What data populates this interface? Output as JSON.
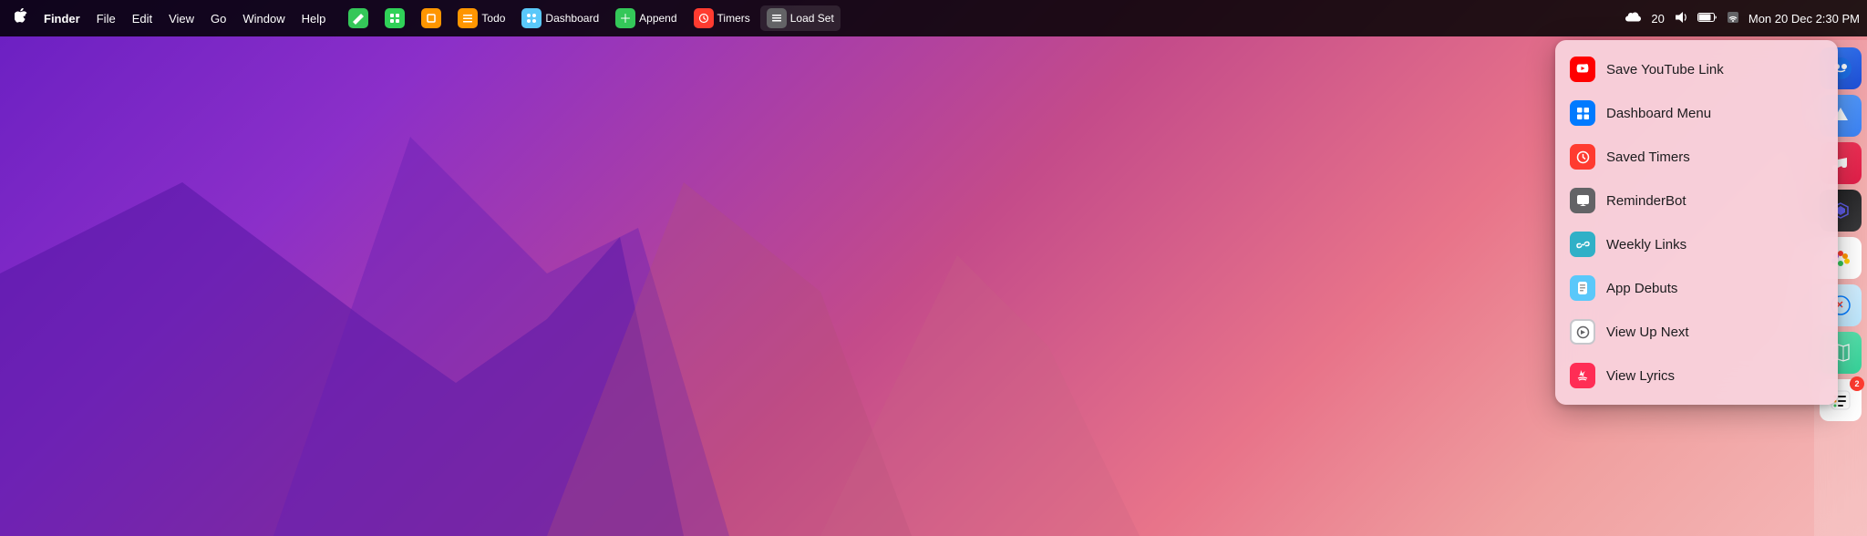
{
  "menubar": {
    "apple_logo": "",
    "finder_label": "Finder",
    "menus": [
      "File",
      "Edit",
      "View",
      "Go",
      "Window",
      "Help"
    ],
    "apps": [
      {
        "id": "pencil",
        "label": "",
        "icon_char": "✏️",
        "color": "#34c759"
      },
      {
        "id": "green",
        "label": "",
        "icon_char": "▣",
        "color": "#30d158"
      },
      {
        "id": "orange-sq",
        "label": "",
        "icon_char": "□",
        "color": "#ff9500"
      },
      {
        "id": "todo",
        "label": "Todo",
        "icon_char": "☰",
        "color": "#ff9500"
      },
      {
        "id": "dashboard",
        "label": "Dashboard",
        "icon_char": "⊞",
        "color": "#5ac8fa"
      },
      {
        "id": "append",
        "label": "Append",
        "icon_char": "+",
        "color": "#34c759"
      },
      {
        "id": "timers",
        "label": "Timers",
        "icon_char": "⏱",
        "color": "#ff3b30"
      },
      {
        "id": "loadset",
        "label": "Load Set",
        "icon_char": "≡",
        "color": "#636366"
      }
    ],
    "system_icons": [
      "icloud",
      "calendar",
      "volume",
      "battery",
      "wifi"
    ],
    "datetime": "Mon 20 Dec  2:30 PM"
  },
  "dropdown": {
    "items": [
      {
        "id": "save-youtube",
        "label": "Save YouTube Link",
        "icon_type": "youtube",
        "icon_char": "▶"
      },
      {
        "id": "dashboard-menu",
        "label": "Dashboard Menu",
        "icon_type": "dashboard",
        "icon_char": "⊞"
      },
      {
        "id": "saved-timers",
        "label": "Saved Timers",
        "icon_type": "timers",
        "icon_char": "⏱"
      },
      {
        "id": "reminder-bot",
        "label": "ReminderBot",
        "icon_type": "reminder",
        "icon_char": "⊡"
      },
      {
        "id": "weekly-links",
        "label": "Weekly Links",
        "icon_type": "weekly",
        "icon_char": "🔗"
      },
      {
        "id": "app-debuts",
        "label": "App Debuts",
        "icon_type": "debuts",
        "icon_char": "📱"
      },
      {
        "id": "view-up-next",
        "label": "View Up Next",
        "icon_type": "upnext",
        "icon_char": "⏭"
      },
      {
        "id": "view-lyrics",
        "label": "View Lyrics",
        "icon_type": "lyrics",
        "icon_char": "♪"
      }
    ]
  },
  "dock": {
    "icons": [
      {
        "id": "finder",
        "color": "#007aff",
        "char": "🔵",
        "badge": null
      },
      {
        "id": "appstore",
        "color": "#007aff",
        "char": "🅰",
        "badge": null
      },
      {
        "id": "music",
        "color": "#ff2d55",
        "char": "🎵",
        "badge": null
      },
      {
        "id": "shortcuts",
        "color": "#111",
        "char": "◈",
        "badge": null
      },
      {
        "id": "photos",
        "color": "#ff9500",
        "char": "🌸",
        "badge": null
      },
      {
        "id": "safari",
        "color": "#007aff",
        "char": "🧭",
        "badge": null
      },
      {
        "id": "maps",
        "color": "#34c759",
        "char": "🗺",
        "badge": null
      },
      {
        "id": "reminders",
        "color": "#ff3b30",
        "char": "📋",
        "badge": "2"
      }
    ]
  }
}
